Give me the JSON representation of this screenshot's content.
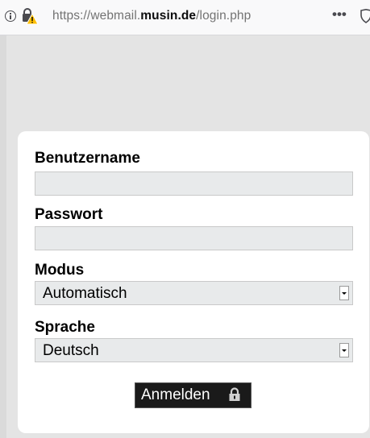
{
  "browser": {
    "url_prefix": "https://webmail.",
    "url_host": "musin.de",
    "url_path": "/login.php",
    "more_label": "•••",
    "icons": [
      "info-icon",
      "insecure-lock-warning-icon",
      "more-icon",
      "shield-icon"
    ]
  },
  "form": {
    "username": {
      "label": "Benutzername",
      "value": "",
      "placeholder": ""
    },
    "password": {
      "label": "Passwort",
      "value": "",
      "placeholder": ""
    },
    "mode": {
      "label": "Modus",
      "selected": "Automatisch"
    },
    "language": {
      "label": "Sprache",
      "selected": "Deutsch"
    },
    "submit_label": "Anmelden",
    "submit_icon": "padlock-icon"
  },
  "colors": {
    "page_background": "#e4e4e4",
    "card_background": "#ffffff",
    "input_background": "#e8eaeb",
    "button_background": "#1a1a1a",
    "warning_yellow": "#ffbf00"
  }
}
